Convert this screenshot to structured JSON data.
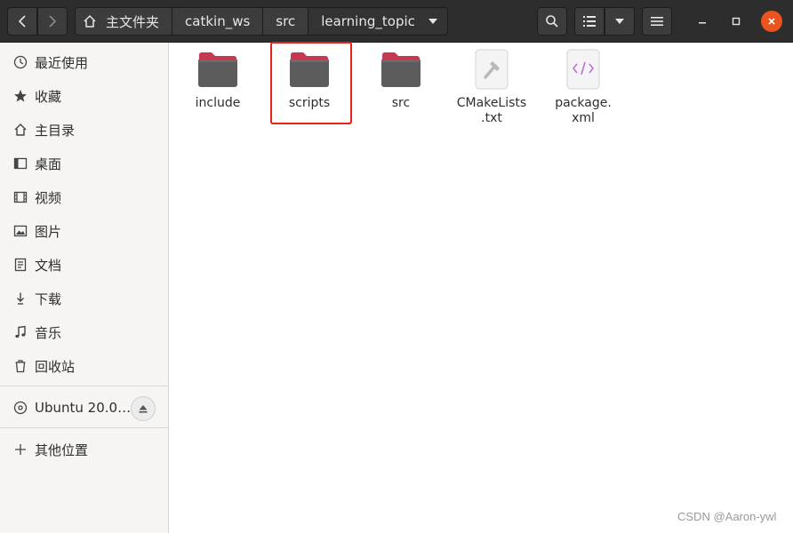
{
  "header": {
    "breadcrumbs": [
      "主文件夹",
      "catkin_ws",
      "src",
      "learning_topic"
    ]
  },
  "sidebar": {
    "items": [
      {
        "label": "最近使用",
        "icon": "clock-icon"
      },
      {
        "label": "收藏",
        "icon": "star-icon"
      },
      {
        "label": "主目录",
        "icon": "home-icon"
      },
      {
        "label": "桌面",
        "icon": "desktop-icon"
      },
      {
        "label": "视频",
        "icon": "video-icon"
      },
      {
        "label": "图片",
        "icon": "picture-icon"
      },
      {
        "label": "文档",
        "icon": "document-icon"
      },
      {
        "label": "下载",
        "icon": "download-icon"
      },
      {
        "label": "音乐",
        "icon": "music-icon"
      },
      {
        "label": "回收站",
        "icon": "trash-icon"
      }
    ],
    "device": {
      "label": "Ubuntu 20.0…",
      "icon": "disc-icon"
    },
    "other": {
      "label": "其他位置",
      "icon": "plus-icon"
    }
  },
  "files": [
    {
      "name": "include",
      "type": "folder"
    },
    {
      "name": "scripts",
      "type": "folder"
    },
    {
      "name": "src",
      "type": "folder"
    },
    {
      "name": "CMakeLists\n.txt",
      "type": "cmake"
    },
    {
      "name": "package.\nxml",
      "type": "xml"
    }
  ],
  "watermark": "CSDN @Aaron-ywl",
  "colors": {
    "header_bg": "#2d2d2d",
    "folder_body": "#5c5c5c",
    "folder_tab": "#c5384f",
    "close_button": "#e9541f",
    "highlight_border": "#e8221b"
  }
}
